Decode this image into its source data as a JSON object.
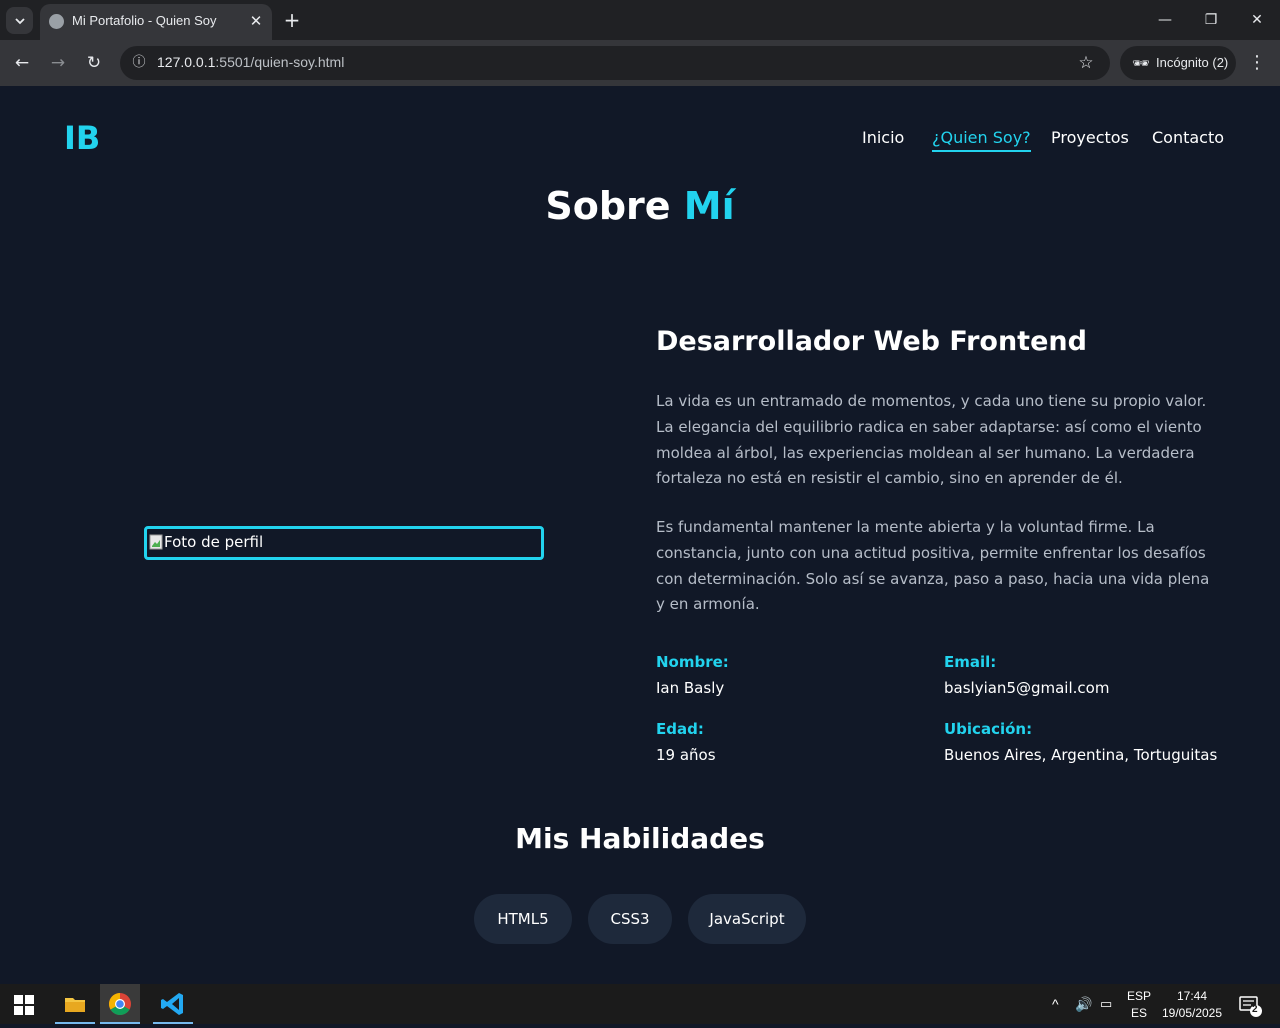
{
  "browser": {
    "tab_title": "Mi Portafolio - Quien Soy",
    "url_host": "127.0.0.1",
    "url_path": ":5501/quien-soy.html",
    "incognito_label": "Incógnito (2)"
  },
  "site": {
    "logo": "IB",
    "nav": [
      {
        "label": "Inicio"
      },
      {
        "label": "¿Quien Soy?"
      },
      {
        "label": "Proyectos"
      },
      {
        "label": "Contacto"
      }
    ],
    "active_nav": "¿Quien Soy?",
    "accent_color": "#22d3ee",
    "background_color": "#111827"
  },
  "hero": {
    "title_plain": "Sobre",
    "title_accent": "Mí"
  },
  "profile": {
    "photo_alt": "Foto de perfil",
    "role": "Desarrollador Web Frontend",
    "paragraphs": [
      "La vida es un entramado de momentos, y cada uno tiene su propio valor. La elegancia del equilibrio radica en saber adaptarse: así como el viento moldea al árbol, las experiencias moldean al ser humano. La verdadera fortaleza no está en resistir el cambio, sino en aprender de él.",
      "Es fundamental mantener la mente abierta y la voluntad firme. La constancia, junto con una actitud positiva, permite enfrentar los desafíos con determinación. Solo así se avanza, paso a paso, hacia una vida plena y en armonía."
    ],
    "info": {
      "name_label": "Nombre:",
      "name_value": "Ian Basly",
      "email_label": "Email:",
      "email_value": "baslyian5@gmail.com",
      "age_label": "Edad:",
      "age_value": "19 años",
      "location_label": "Ubicación:",
      "location_value": "Buenos Aires, Argentina, Tortuguitas"
    }
  },
  "skills": {
    "title": "Mis Habilidades",
    "items": [
      "HTML5",
      "CSS3",
      "JavaScript"
    ]
  },
  "taskbar": {
    "lang_top": "ESP",
    "lang_bottom": "ES",
    "time": "17:44",
    "date": "19/05/2025",
    "notification_count": "2"
  }
}
